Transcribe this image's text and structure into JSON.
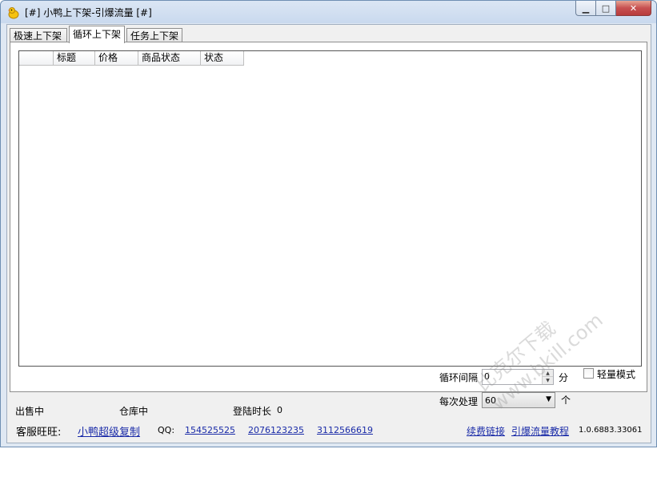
{
  "window": {
    "title": "[#] 小鸭上下架-引爆流量 [#]",
    "controls": {
      "minimize": "▁",
      "maximize": "□",
      "close": "✕"
    }
  },
  "tabs": [
    {
      "label": "极速上下架",
      "active": false
    },
    {
      "label": "循环上下架",
      "active": true
    },
    {
      "label": "任务上下架",
      "active": false
    }
  ],
  "table": {
    "columns": [
      "",
      "标题",
      "价格",
      "商品状态",
      "状态"
    ],
    "rows": []
  },
  "settings": {
    "loop_interval_label": "循环间隔",
    "loop_interval_value": "0",
    "loop_interval_unit": "分",
    "light_mode_label": "轻量模式",
    "light_mode_checked": false,
    "batch_label": "每次处理",
    "batch_value": "60",
    "batch_unit": "个"
  },
  "status": {
    "on_sale": "出售中",
    "in_warehouse": "仓库中",
    "login_duration_label": "登陆时长",
    "login_duration_value": "0"
  },
  "footer": {
    "service_label": "客服旺旺:",
    "service_link": "小鸭超级复制",
    "qq_label": "QQ:",
    "qq_numbers": [
      "154525525",
      "2076123235",
      "3112566619"
    ],
    "renew_link": "续费链接",
    "tutorial_link": "引爆流量教程",
    "version": "1.0.6883.33061"
  },
  "watermark": {
    "line1": "比克尔下载",
    "line2": "www.bkill.com"
  },
  "colors": {
    "link": "#1a2ba8",
    "titlebar": "#c9d9ee",
    "close_button": "#c75050"
  }
}
